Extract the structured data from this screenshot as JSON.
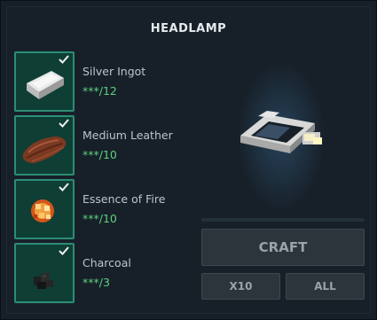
{
  "title": "HEADLAMP",
  "ingredients": [
    {
      "name": "Silver Ingot",
      "count": "***/12",
      "icon": "silver-ingot-icon",
      "complete": true
    },
    {
      "name": "Medium Leather",
      "count": "***/10",
      "icon": "medium-leather-icon",
      "complete": true
    },
    {
      "name": "Essence of Fire",
      "count": "***/10",
      "icon": "essence-of-fire-icon",
      "complete": true
    },
    {
      "name": "Charcoal",
      "count": "***/3",
      "icon": "charcoal-icon",
      "complete": true
    }
  ],
  "preview": {
    "icon": "headlamp-icon"
  },
  "buttons": {
    "craft": "CRAFT",
    "x10": "X10",
    "all": "ALL"
  },
  "colors": {
    "slot_bg": "#0f3e35",
    "slot_border": "#2b8e74",
    "count_text": "#5bd17f",
    "panel_bg": "#172029"
  }
}
